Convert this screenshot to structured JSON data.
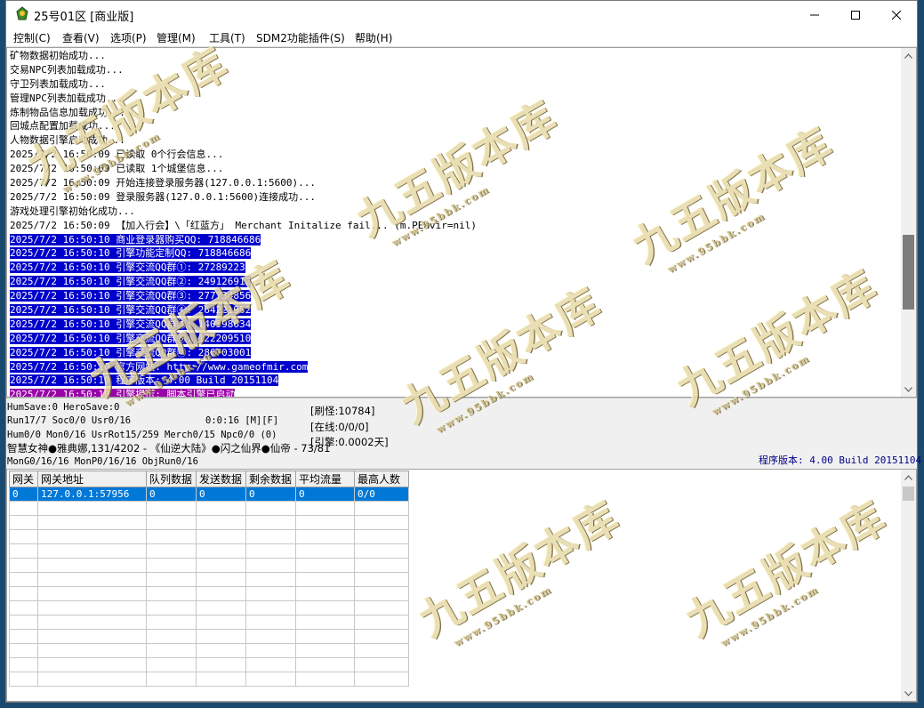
{
  "window": {
    "title": "25号01区 [商业版]"
  },
  "menu": [
    "控制(C)",
    "查看(V)",
    "选项(P)",
    "管理(M)",
    "工具(T)",
    "SDM2功能插件(S)",
    "帮助(H)"
  ],
  "log": [
    "矿物数据初始成功...",
    "交易NPC列表加载成功...",
    "守卫列表加载成功...",
    "管理NPC列表加载成功...",
    "炼制物品信息加载成功...",
    "回城点配置加载成功...",
    "人物数据引擎启动成功...",
    "2025/7/2 16:50:09 已读取 0个行会信息...",
    "2025/7/2 16:50:09 已读取 1个城堡信息...",
    "2025/7/2 16:50:09 开始连接登录服务器(127.0.0.1:5600)...",
    "2025/7/2 16:50:09 登录服务器(127.0.0.1:5600)连接成功...",
    "游戏处理引擎初始化成功...",
    "2025/7/2 16:50:09 【加入行会】\\「红蓝方」 Merchant Initalize fail... (m.PEnvir=nil)",
    "2025/7/2 16:50:10 商业登录器购买QQ: 718846686",
    "2025/7/2 16:50:10 引擎功能定制QQ: 718846686",
    "2025/7/2 16:50:10 引擎交流QQ群①: 27289223",
    "2025/7/2 16:50:10 引擎交流QQ群②: 249126912",
    "2025/7/2 16:50:10 引擎交流QQ群③: 277734856",
    "2025/7/2 16:50:10 引擎交流QQ群④: 264221952",
    "2025/7/2 16:50:10 引擎交流QQ群⑤: 140598634",
    "2025/7/2 16:50:10 引擎交流QQ群⑥: 122209510",
    "2025/7/2 16:50:10 引擎交流QQ群⑦: 286703001",
    "2025/7/2 16:50:10 官方网站: http://www.gameofmir.com",
    "2025/7/2 16:50:10 程序版本: 4.00 Build 20151104",
    "2025/7/2 16:50:10 引擎提示: 脚本引擎已启动"
  ],
  "status": {
    "line1": "HumSave:0 HeroSave:0",
    "line2a": "Run17/7 Soc0/0 Usr0/16",
    "line2b": "0:0:16 [M][F]",
    "line3": "Hum0/0 Mon0/16 UsrRot15/259 Merch0/15 Npc0/0 (0)",
    "line4": "智慧女神●雅典娜,131/4202 - 《仙逆大陆》●闪之仙界●仙帝 - 73/81",
    "line5": "MonG0/16/16 MonP0/16/16 ObjRun0/16",
    "refresh": "[刷怪:10784]",
    "online": "[在线:0/0/0]",
    "engine": "[引擎:0.0002天]",
    "version": "程序版本: 4.00 Build 20151104"
  },
  "grid": {
    "columns": [
      "网关",
      "网关地址",
      "队列数据",
      "发送数据",
      "剩余数据",
      "平均流量",
      "最高人数"
    ],
    "rows": [
      [
        "0",
        "127.0.0.1:57956",
        "0",
        "0",
        "0",
        "0",
        "0/0"
      ]
    ]
  },
  "watermark": {
    "text": "九五版本库",
    "url": "www.95bbk.com"
  }
}
